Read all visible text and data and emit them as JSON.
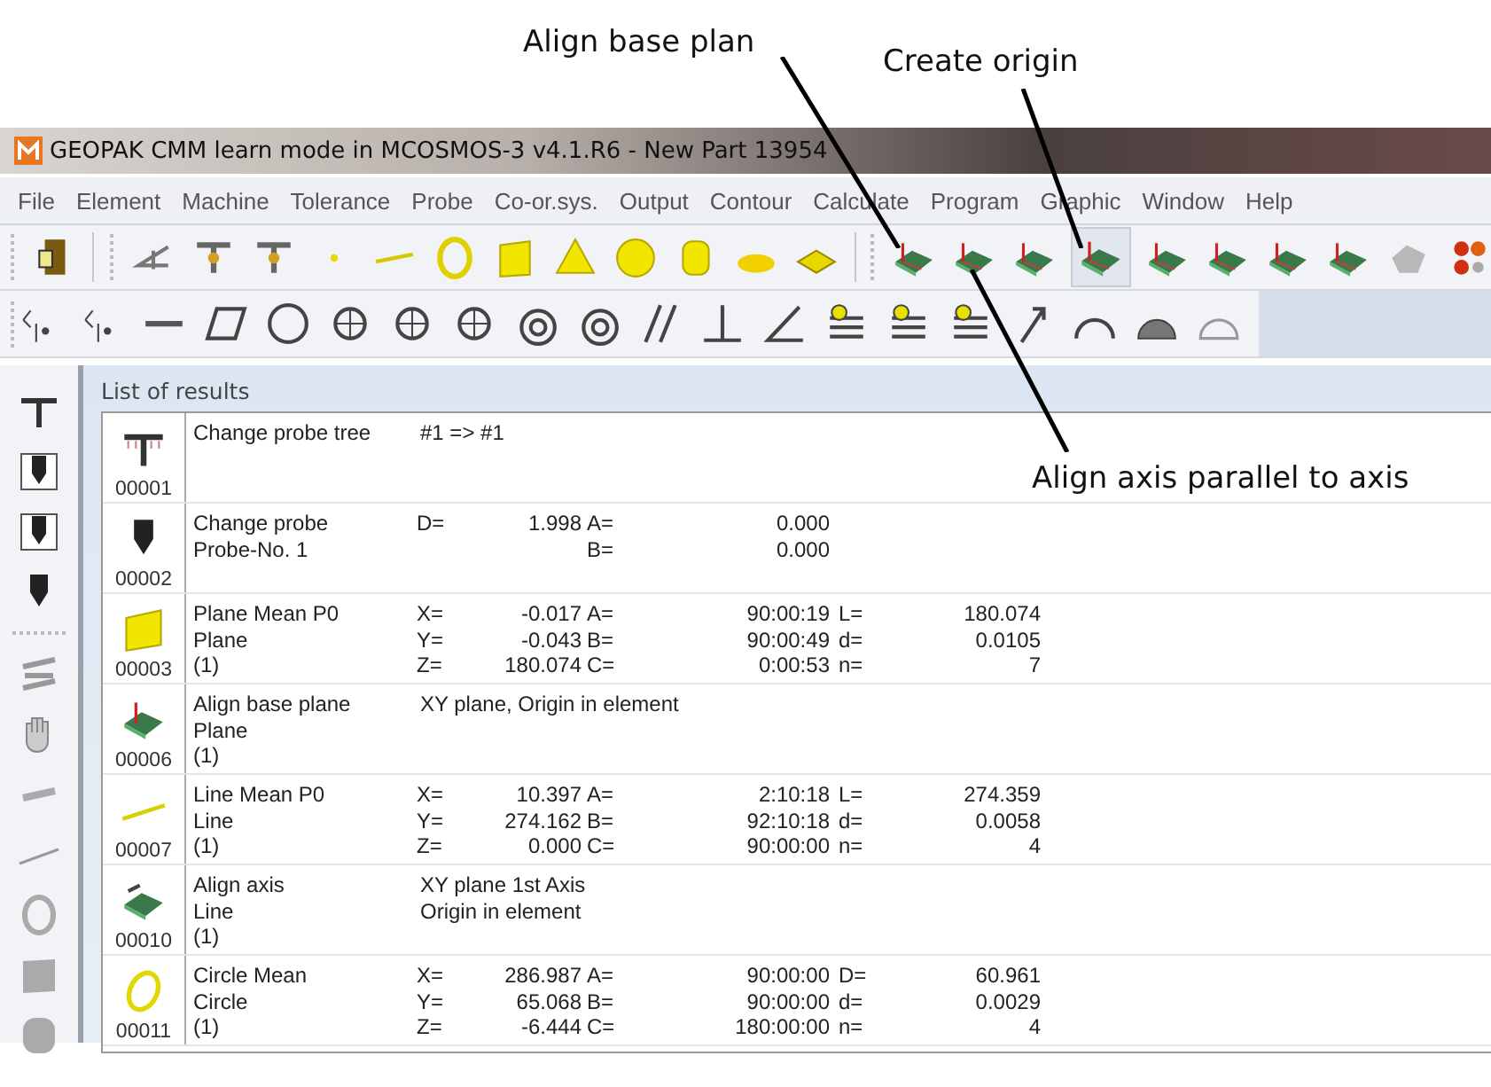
{
  "annotations": [
    {
      "text": "Align base plan"
    },
    {
      "text": "Create origin"
    },
    {
      "text": "Align axis parallel to axis"
    }
  ],
  "window": {
    "title": "GEOPAK CMM learn mode in MCOSMOS-3 v4.1.R6  - New Part 13954"
  },
  "menu": [
    "File",
    "Element",
    "Machine",
    "Tolerance",
    "Probe",
    "Co-or.sys.",
    "Output",
    "Contour",
    "Calculate",
    "Program",
    "Graphic",
    "Window",
    "Help"
  ],
  "alignment_buttons": [
    {
      "selected": false
    },
    {
      "selected": false
    },
    {
      "selected": false
    },
    {
      "selected": true
    },
    {
      "selected": false
    },
    {
      "selected": false
    },
    {
      "selected": false
    },
    {
      "selected": false
    }
  ],
  "results": {
    "title": "List of results",
    "rows": [
      {
        "number": "00001",
        "kind": "probe-tree",
        "lines": [
          {
            "name": "Change probe tree",
            "note": "#1 => #1"
          }
        ]
      },
      {
        "number": "00002",
        "kind": "probe",
        "lines": [
          {
            "name": "Change probe",
            "label_1": "D=",
            "value_1": "1.998",
            "label_2": "A=",
            "value_2": "0.000"
          },
          {
            "name": "Probe-No.  1",
            "label_2": "B=",
            "value_2": "0.000"
          }
        ]
      },
      {
        "number": "00003",
        "kind": "plane",
        "lines": [
          {
            "name": "Plane  Mean  P0",
            "label_1": "X=",
            "value_1": "-0.017",
            "label_2": "A=",
            "value_2": "90:00:19",
            "label_3": "L=",
            "value_3": "180.074"
          },
          {
            "name": "Plane",
            "label_1": "Y=",
            "value_1": "-0.043",
            "label_2": "B=",
            "value_2": "90:00:49",
            "label_3": "d=",
            "value_3": "0.0105"
          },
          {
            "name": "(1)",
            "label_1": "Z=",
            "value_1": "180.074",
            "label_2": "C=",
            "value_2": "0:00:53",
            "label_3": "n=",
            "value_3": "7"
          }
        ]
      },
      {
        "number": "00006",
        "kind": "align-plane",
        "lines": [
          {
            "name": "Align base plane",
            "note": "XY plane, Origin in element"
          },
          {
            "name": "Plane"
          },
          {
            "name": "(1)"
          }
        ]
      },
      {
        "number": "00007",
        "kind": "line",
        "lines": [
          {
            "name": "Line  Mean  P0",
            "label_1": "X=",
            "value_1": "10.397",
            "label_2": "A=",
            "value_2": "2:10:18",
            "label_3": "L=",
            "value_3": "274.359"
          },
          {
            "name": "Line",
            "label_1": "Y=",
            "value_1": "274.162",
            "label_2": "B=",
            "value_2": "92:10:18",
            "label_3": "d=",
            "value_3": "0.0058"
          },
          {
            "name": "(1)",
            "label_1": "Z=",
            "value_1": "0.000",
            "label_2": "C=",
            "value_2": "90:00:00",
            "label_3": "n=",
            "value_3": "4"
          }
        ]
      },
      {
        "number": "00010",
        "kind": "align-axis",
        "lines": [
          {
            "name": "Align axis",
            "note": "XY plane 1st Axis"
          },
          {
            "name": "Line",
            "note": "Origin in element"
          },
          {
            "name": "(1)"
          }
        ]
      },
      {
        "number": "00011",
        "kind": "circle",
        "lines": [
          {
            "name": "Circle  Mean",
            "label_1": "X=",
            "value_1": "286.987",
            "label_2": "A=",
            "value_2": "90:00:00",
            "label_3": "D=",
            "value_3": "60.961"
          },
          {
            "name": "Circle",
            "label_1": "Y=",
            "value_1": "65.068",
            "label_2": "B=",
            "value_2": "90:00:00",
            "label_3": "d=",
            "value_3": "0.0029"
          },
          {
            "name": "(1)",
            "label_1": "Z=",
            "value_1": "-6.444",
            "label_2": "C=",
            "value_2": "180:00:00",
            "label_3": "n=",
            "value_3": "4"
          }
        ]
      }
    ]
  }
}
